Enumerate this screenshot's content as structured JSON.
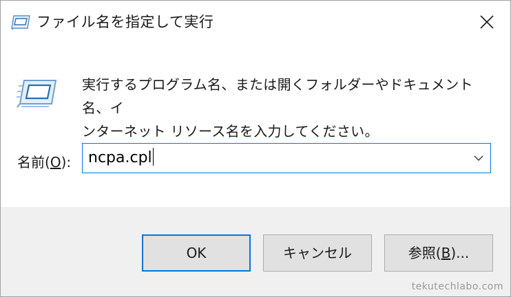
{
  "window": {
    "title": "ファイル名を指定して実行"
  },
  "content": {
    "description_line1": "実行するプログラム名、または開くフォルダーやドキュメント名、イ",
    "description_line2": "ンターネット リソース名を入力してください。",
    "open_label_prefix": "名前(",
    "open_label_key": "O",
    "open_label_suffix": "):",
    "open_value": "ncpa.cpl"
  },
  "buttons": {
    "ok_label": "OK",
    "cancel_label": "キャンセル",
    "browse_prefix": "参照(",
    "browse_key": "B",
    "browse_suffix": ")..."
  },
  "watermark": "tekutechlabo.com",
  "icons": {
    "title": "run-icon",
    "main": "run-icon",
    "close": "close-icon",
    "dropdown": "chevron-down-icon"
  },
  "colors": {
    "accent": "#0078d7",
    "footer_bg": "#f0f0f0",
    "button_bg": "#e1e1e1"
  }
}
